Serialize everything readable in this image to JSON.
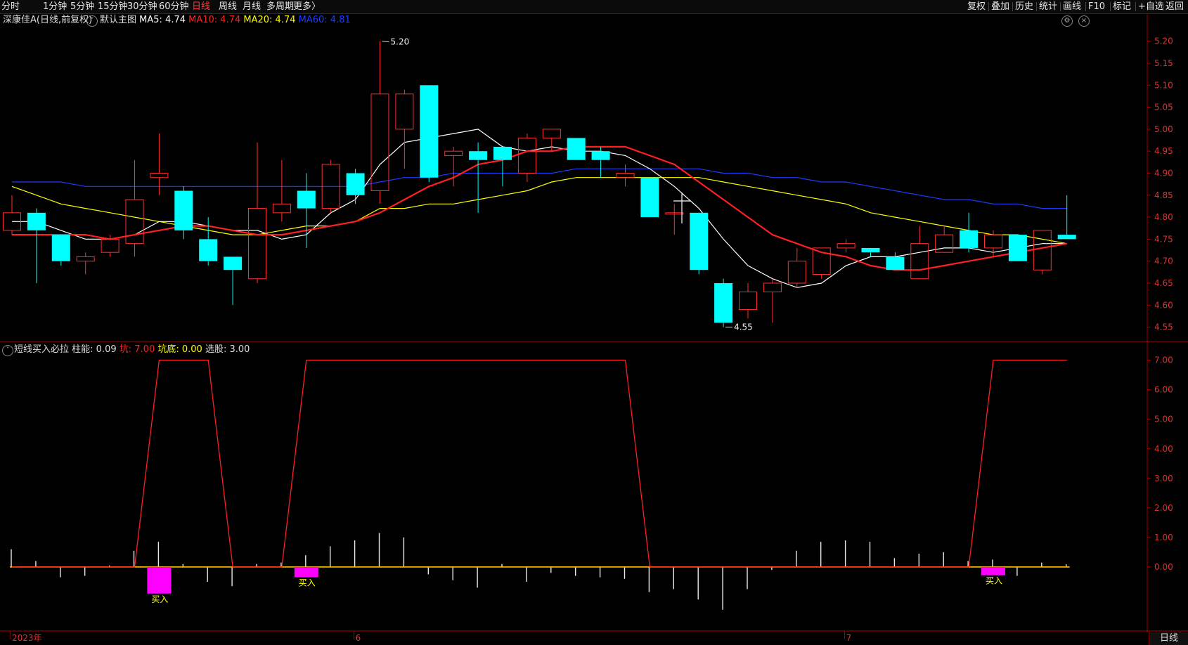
{
  "toolbar": {
    "left_items": [
      "分时",
      "1分钟",
      "5分钟",
      "15分钟",
      "30分钟",
      "60分钟",
      "日线",
      "周线",
      "月线",
      "多周期",
      "更多〉"
    ],
    "active": "日线",
    "right_items": [
      "复权",
      "叠加",
      "历史",
      "统计",
      "画线",
      "F10",
      "标记",
      "+自选",
      "返回"
    ]
  },
  "main_info": {
    "stock": "深康佳A",
    "mode": "(日线,前复权)",
    "template": "默认主图",
    "ma": [
      {
        "label": "MA5: 4.74",
        "color": "#ffffff"
      },
      {
        "label": "MA10: 4.74",
        "color": "#ff2020"
      },
      {
        "label": "MA20: 4.74",
        "color": "#ffff00"
      },
      {
        "label": "MA60: 4.81",
        "color": "#1e3cff"
      }
    ]
  },
  "ind_info": {
    "name": "短线买入必拉",
    "items": [
      {
        "label": "柱能: 0.09",
        "color": "#dddddd"
      },
      {
        "label": "坑: 7.00",
        "color": "#ff2020"
      },
      {
        "label": "坑底: 0.00",
        "color": "#ffff00"
      },
      {
        "label": "选股: 3.00",
        "color": "#dddddd"
      }
    ]
  },
  "colors": {
    "up": "#ff3030",
    "down": "#00ffff",
    "ma5": "#ffffff",
    "ma10": "#ff2020",
    "ma20": "#ffff00",
    "ma60": "#1e3cff",
    "axis": "#aa0000",
    "buy": "#ff00ff"
  },
  "chart_data": [
    {
      "type": "candlestick",
      "title": "深康佳A (日线,前复权)",
      "y_ticks": [
        "5.20",
        "5.15",
        "5.10",
        "5.05",
        "5.00",
        "4.95",
        "4.90",
        "4.85",
        "4.80",
        "4.75",
        "4.70",
        "4.65",
        "4.60",
        "4.55"
      ],
      "ylim": [
        4.535,
        5.225
      ],
      "x_labels": [
        {
          "i": 0,
          "label": "2023年"
        },
        {
          "i": 14,
          "label": "6"
        },
        {
          "i": 34,
          "label": "7"
        }
      ],
      "annotations": [
        {
          "i": 15,
          "value": 5.2,
          "label": "5.20"
        },
        {
          "i": 29,
          "value": 4.55,
          "label": "4.55"
        }
      ],
      "candles": [
        {
          "o": 4.77,
          "h": 4.85,
          "l": 4.76,
          "c": 4.81
        },
        {
          "o": 4.81,
          "h": 4.82,
          "l": 4.65,
          "c": 4.77
        },
        {
          "o": 4.76,
          "h": 4.76,
          "l": 4.69,
          "c": 4.7
        },
        {
          "o": 4.7,
          "h": 4.72,
          "l": 4.67,
          "c": 4.71
        },
        {
          "o": 4.72,
          "h": 4.76,
          "l": 4.71,
          "c": 4.75
        },
        {
          "o": 4.74,
          "h": 4.93,
          "l": 4.71,
          "c": 4.84
        },
        {
          "o": 4.89,
          "h": 4.99,
          "l": 4.85,
          "c": 4.9
        },
        {
          "o": 4.86,
          "h": 4.87,
          "l": 4.75,
          "c": 4.77
        },
        {
          "o": 4.75,
          "h": 4.8,
          "l": 4.69,
          "c": 4.7
        },
        {
          "o": 4.71,
          "h": 4.71,
          "l": 4.6,
          "c": 4.68
        },
        {
          "o": 4.66,
          "h": 4.97,
          "l": 4.65,
          "c": 4.82
        },
        {
          "o": 4.81,
          "h": 4.93,
          "l": 4.79,
          "c": 4.83
        },
        {
          "o": 4.86,
          "h": 4.9,
          "l": 4.73,
          "c": 4.82
        },
        {
          "o": 4.82,
          "h": 4.93,
          "l": 4.81,
          "c": 4.92
        },
        {
          "o": 4.9,
          "h": 4.91,
          "l": 4.83,
          "c": 4.85
        },
        {
          "o": 4.86,
          "h": 5.2,
          "l": 4.83,
          "c": 5.08
        },
        {
          "o": 5.0,
          "h": 5.09,
          "l": 4.91,
          "c": 5.08
        },
        {
          "o": 5.1,
          "h": 5.1,
          "l": 4.88,
          "c": 4.89
        },
        {
          "o": 4.94,
          "h": 4.96,
          "l": 4.87,
          "c": 4.95
        },
        {
          "o": 4.95,
          "h": 4.97,
          "l": 4.81,
          "c": 4.93
        },
        {
          "o": 4.96,
          "h": 4.96,
          "l": 4.87,
          "c": 4.93
        },
        {
          "o": 4.9,
          "h": 4.99,
          "l": 4.88,
          "c": 4.98
        },
        {
          "o": 4.98,
          "h": 5.0,
          "l": 4.95,
          "c": 5.0
        },
        {
          "o": 4.98,
          "h": 4.98,
          "l": 4.93,
          "c": 4.93
        },
        {
          "o": 4.95,
          "h": 4.96,
          "l": 4.89,
          "c": 4.93
        },
        {
          "o": 4.89,
          "h": 4.92,
          "l": 4.87,
          "c": 4.9
        },
        {
          "o": 4.89,
          "h": 4.89,
          "l": 4.8,
          "c": 4.8
        },
        {
          "o": 4.81,
          "h": 4.83,
          "l": 4.76,
          "c": 4.81
        },
        {
          "o": 4.81,
          "h": 4.81,
          "l": 4.67,
          "c": 4.68
        },
        {
          "o": 4.65,
          "h": 4.66,
          "l": 4.55,
          "c": 4.56
        },
        {
          "o": 4.59,
          "h": 4.65,
          "l": 4.57,
          "c": 4.63
        },
        {
          "o": 4.63,
          "h": 4.66,
          "l": 4.56,
          "c": 4.65
        },
        {
          "o": 4.65,
          "h": 4.73,
          "l": 4.64,
          "c": 4.7
        },
        {
          "o": 4.67,
          "h": 4.73,
          "l": 4.66,
          "c": 4.73
        },
        {
          "o": 4.73,
          "h": 4.75,
          "l": 4.72,
          "c": 4.74
        },
        {
          "o": 4.73,
          "h": 4.73,
          "l": 4.71,
          "c": 4.72
        },
        {
          "o": 4.71,
          "h": 4.72,
          "l": 4.68,
          "c": 4.68
        },
        {
          "o": 4.66,
          "h": 4.78,
          "l": 4.66,
          "c": 4.74
        },
        {
          "o": 4.72,
          "h": 4.78,
          "l": 4.72,
          "c": 4.76
        },
        {
          "o": 4.77,
          "h": 4.81,
          "l": 4.72,
          "c": 4.73
        },
        {
          "o": 4.73,
          "h": 4.77,
          "l": 4.71,
          "c": 4.76
        },
        {
          "o": 4.76,
          "h": 4.76,
          "l": 4.7,
          "c": 4.7
        },
        {
          "o": 4.68,
          "h": 4.77,
          "l": 4.67,
          "c": 4.77
        },
        {
          "o": 4.76,
          "h": 4.85,
          "l": 4.75,
          "c": 4.75
        }
      ],
      "ma5": [
        4.79,
        4.79,
        4.77,
        4.75,
        4.75,
        4.76,
        4.79,
        4.79,
        4.78,
        4.77,
        4.77,
        4.75,
        4.76,
        4.81,
        4.84,
        4.92,
        4.97,
        4.98,
        4.99,
        5.0,
        4.96,
        4.95,
        4.96,
        4.95,
        4.95,
        4.94,
        4.91,
        4.87,
        4.82,
        4.75,
        4.69,
        4.66,
        4.64,
        4.65,
        4.69,
        4.71,
        4.71,
        4.72,
        4.73,
        4.73,
        4.72,
        4.73,
        4.74,
        4.74
      ],
      "ma10": [
        4.76,
        4.76,
        4.76,
        4.76,
        4.75,
        4.76,
        4.77,
        4.78,
        4.78,
        4.77,
        4.76,
        4.76,
        4.77,
        4.78,
        4.79,
        4.81,
        4.84,
        4.87,
        4.89,
        4.92,
        4.93,
        4.95,
        4.95,
        4.96,
        4.96,
        4.96,
        4.94,
        4.92,
        4.88,
        4.84,
        4.8,
        4.76,
        4.74,
        4.72,
        4.71,
        4.69,
        4.68,
        4.68,
        4.69,
        4.7,
        4.71,
        4.72,
        4.73,
        4.74
      ],
      "ma20": [
        4.87,
        4.85,
        4.83,
        4.82,
        4.81,
        4.8,
        4.79,
        4.78,
        4.77,
        4.76,
        4.76,
        4.77,
        4.78,
        4.78,
        4.79,
        4.82,
        4.82,
        4.83,
        4.83,
        4.84,
        4.85,
        4.86,
        4.88,
        4.89,
        4.89,
        4.89,
        4.89,
        4.89,
        4.89,
        4.88,
        4.87,
        4.86,
        4.85,
        4.84,
        4.83,
        4.81,
        4.8,
        4.79,
        4.78,
        4.77,
        4.76,
        4.76,
        4.75,
        4.74
      ],
      "ma60": [
        4.88,
        4.88,
        4.88,
        4.87,
        4.87,
        4.87,
        4.87,
        4.87,
        4.87,
        4.87,
        4.87,
        4.87,
        4.87,
        4.87,
        4.87,
        4.88,
        4.89,
        4.89,
        4.9,
        4.9,
        4.9,
        4.9,
        4.9,
        4.91,
        4.91,
        4.91,
        4.91,
        4.91,
        4.91,
        4.9,
        4.9,
        4.89,
        4.89,
        4.88,
        4.88,
        4.87,
        4.86,
        4.85,
        4.84,
        4.84,
        4.83,
        4.83,
        4.82,
        4.82
      ]
    },
    {
      "type": "bar",
      "title": "短线买入必拉",
      "y_ticks": [
        "7.00",
        "6.00",
        "5.00",
        "4.00",
        "3.00",
        "2.00",
        "1.00",
        "0.00"
      ],
      "ylim": [
        -1.5,
        7.3
      ],
      "pit": [
        0,
        0,
        0,
        0,
        0,
        0,
        7,
        7,
        7,
        0,
        0,
        0,
        7,
        7,
        7,
        7,
        7,
        7,
        7,
        7,
        7,
        7,
        7,
        7,
        7,
        7,
        0,
        0,
        0,
        0,
        0,
        0,
        0,
        0,
        0,
        0,
        0,
        0,
        0,
        0,
        7,
        7,
        7,
        7
      ],
      "bars": [
        0.6,
        0.2,
        -0.35,
        -0.3,
        0.05,
        0.55,
        0.85,
        0.1,
        -0.5,
        -0.65,
        0.1,
        0.15,
        0.4,
        0.7,
        0.9,
        1.15,
        1.0,
        -0.25,
        -0.45,
        -0.7,
        0.1,
        -0.5,
        -0.2,
        -0.3,
        -0.35,
        -0.4,
        -0.85,
        -0.75,
        -1.1,
        -1.45,
        -0.75,
        -0.1,
        0.55,
        0.85,
        0.9,
        0.85,
        0.3,
        0.45,
        0.5,
        0.2,
        0.25,
        -0.3,
        0.15,
        0.09
      ],
      "buy_signals": [
        {
          "i": 6,
          "depth": -0.9,
          "label": "买入"
        },
        {
          "i": 12,
          "depth": -0.35,
          "label": "买入"
        },
        {
          "i": 40,
          "depth": -0.28,
          "label": "买入"
        }
      ]
    }
  ],
  "bottom_tab": "日线"
}
